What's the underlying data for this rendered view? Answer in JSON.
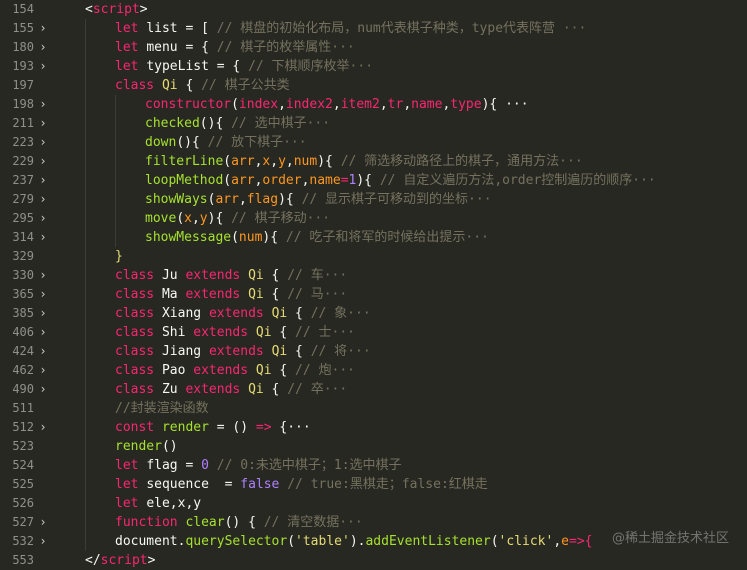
{
  "lines": [
    {
      "num": "154",
      "fold": "",
      "indent": 1,
      "tokens": [
        {
          "t": "<",
          "c": "t-punct"
        },
        {
          "t": "script",
          "c": "t-tag"
        },
        {
          "t": ">",
          "c": "t-punct"
        }
      ]
    },
    {
      "num": "155",
      "fold": "›",
      "indent": 2,
      "tokens": [
        {
          "t": "let ",
          "c": "t-kw2"
        },
        {
          "t": "list",
          "c": "t-plain"
        },
        {
          "t": " = [ ",
          "c": "t-plain"
        },
        {
          "t": "// 棋盘的初始化布局，num代表棋子种类，type代表阵营 ···",
          "c": "t-com"
        }
      ]
    },
    {
      "num": "180",
      "fold": "›",
      "indent": 2,
      "tokens": [
        {
          "t": "let ",
          "c": "t-kw2"
        },
        {
          "t": "menu",
          "c": "t-plain"
        },
        {
          "t": " = { ",
          "c": "t-plain"
        },
        {
          "t": "// 棋子的枚举属性···",
          "c": "t-com"
        }
      ]
    },
    {
      "num": "193",
      "fold": "›",
      "indent": 2,
      "tokens": [
        {
          "t": "let ",
          "c": "t-kw2"
        },
        {
          "t": "typeList",
          "c": "t-plain"
        },
        {
          "t": " = { ",
          "c": "t-plain"
        },
        {
          "t": "// 下棋顺序枚举···",
          "c": "t-com"
        }
      ]
    },
    {
      "num": "197",
      "fold": "",
      "indent": 2,
      "tokens": [
        {
          "t": "class ",
          "c": "t-kw2"
        },
        {
          "t": "Qi",
          "c": "t-yel"
        },
        {
          "t": " { ",
          "c": "t-plain"
        },
        {
          "t": "// 棋子公共类",
          "c": "t-com"
        }
      ]
    },
    {
      "num": "198",
      "fold": "›",
      "indent": 3,
      "tokens": [
        {
          "t": "constructor",
          "c": "t-kw2"
        },
        {
          "t": "(",
          "c": "t-plain"
        },
        {
          "t": "index",
          "c": "t-kw2"
        },
        {
          "t": ",",
          "c": "t-plain"
        },
        {
          "t": "index2",
          "c": "t-kw2"
        },
        {
          "t": ",",
          "c": "t-plain"
        },
        {
          "t": "item2",
          "c": "t-kw2"
        },
        {
          "t": ",",
          "c": "t-plain"
        },
        {
          "t": "tr",
          "c": "t-kw2"
        },
        {
          "t": ",",
          "c": "t-plain"
        },
        {
          "t": "name",
          "c": "t-kw2"
        },
        {
          "t": ",",
          "c": "t-plain"
        },
        {
          "t": "type",
          "c": "t-kw2"
        },
        {
          "t": "){ ···",
          "c": "t-plain"
        }
      ]
    },
    {
      "num": "211",
      "fold": "›",
      "indent": 3,
      "tokens": [
        {
          "t": "checked",
          "c": "t-name"
        },
        {
          "t": "(){ ",
          "c": "t-plain"
        },
        {
          "t": "// 选中棋子···",
          "c": "t-com"
        }
      ]
    },
    {
      "num": "223",
      "fold": "›",
      "indent": 3,
      "tokens": [
        {
          "t": "down",
          "c": "t-name"
        },
        {
          "t": "(){ ",
          "c": "t-plain"
        },
        {
          "t": "// 放下棋子···",
          "c": "t-com"
        }
      ]
    },
    {
      "num": "229",
      "fold": "›",
      "indent": 3,
      "tokens": [
        {
          "t": "filterLine",
          "c": "t-name"
        },
        {
          "t": "(",
          "c": "t-plain"
        },
        {
          "t": "arr",
          "c": "t-param"
        },
        {
          "t": ",",
          "c": "t-plain"
        },
        {
          "t": "x",
          "c": "t-param"
        },
        {
          "t": ",",
          "c": "t-plain"
        },
        {
          "t": "y",
          "c": "t-param"
        },
        {
          "t": ",",
          "c": "t-plain"
        },
        {
          "t": "num",
          "c": "t-param"
        },
        {
          "t": "){ ",
          "c": "t-plain"
        },
        {
          "t": "// 筛选移动路径上的棋子，通用方法···",
          "c": "t-com"
        }
      ]
    },
    {
      "num": "237",
      "fold": "›",
      "indent": 3,
      "tokens": [
        {
          "t": "loopMethod",
          "c": "t-name"
        },
        {
          "t": "(",
          "c": "t-plain"
        },
        {
          "t": "arr",
          "c": "t-param"
        },
        {
          "t": ",",
          "c": "t-plain"
        },
        {
          "t": "order",
          "c": "t-param"
        },
        {
          "t": ",",
          "c": "t-plain"
        },
        {
          "t": "name",
          "c": "t-param"
        },
        {
          "t": "=",
          "c": "t-kw2"
        },
        {
          "t": "1",
          "c": "t-num"
        },
        {
          "t": "){ ",
          "c": "t-plain"
        },
        {
          "t": "// 自定义遍历方法,order控制遍历的顺序···",
          "c": "t-com"
        }
      ]
    },
    {
      "num": "279",
      "fold": "›",
      "indent": 3,
      "tokens": [
        {
          "t": "showWays",
          "c": "t-name"
        },
        {
          "t": "(",
          "c": "t-plain"
        },
        {
          "t": "arr",
          "c": "t-param"
        },
        {
          "t": ",",
          "c": "t-plain"
        },
        {
          "t": "flag",
          "c": "t-param"
        },
        {
          "t": "){ ",
          "c": "t-plain"
        },
        {
          "t": "// 显示棋子可移动到的坐标···",
          "c": "t-com"
        }
      ]
    },
    {
      "num": "295",
      "fold": "›",
      "indent": 3,
      "tokens": [
        {
          "t": "move",
          "c": "t-name"
        },
        {
          "t": "(",
          "c": "t-plain"
        },
        {
          "t": "x",
          "c": "t-param"
        },
        {
          "t": ",",
          "c": "t-plain"
        },
        {
          "t": "y",
          "c": "t-param"
        },
        {
          "t": "){ ",
          "c": "t-plain"
        },
        {
          "t": "// 棋子移动···",
          "c": "t-com"
        }
      ]
    },
    {
      "num": "314",
      "fold": "›",
      "indent": 3,
      "tokens": [
        {
          "t": "showMessage",
          "c": "t-name"
        },
        {
          "t": "(",
          "c": "t-plain"
        },
        {
          "t": "num",
          "c": "t-param"
        },
        {
          "t": "){ ",
          "c": "t-plain"
        },
        {
          "t": "// 吃子和将军的时候给出提示···",
          "c": "t-com"
        }
      ]
    },
    {
      "num": "329",
      "fold": "",
      "indent": 2,
      "tokens": [
        {
          "t": "}",
          "c": "t-yel"
        }
      ]
    },
    {
      "num": "330",
      "fold": "›",
      "indent": 2,
      "tokens": [
        {
          "t": "class ",
          "c": "t-kw2"
        },
        {
          "t": "Ju ",
          "c": "t-plain"
        },
        {
          "t": "extends ",
          "c": "t-kw2"
        },
        {
          "t": "Qi",
          "c": "t-yel"
        },
        {
          "t": " { ",
          "c": "t-plain"
        },
        {
          "t": "// 车···",
          "c": "t-com"
        }
      ]
    },
    {
      "num": "365",
      "fold": "›",
      "indent": 2,
      "tokens": [
        {
          "t": "class ",
          "c": "t-kw2"
        },
        {
          "t": "Ma ",
          "c": "t-plain"
        },
        {
          "t": "extends ",
          "c": "t-kw2"
        },
        {
          "t": "Qi",
          "c": "t-yel"
        },
        {
          "t": " { ",
          "c": "t-plain"
        },
        {
          "t": "// 马···",
          "c": "t-com"
        }
      ]
    },
    {
      "num": "385",
      "fold": "›",
      "indent": 2,
      "tokens": [
        {
          "t": "class ",
          "c": "t-kw2"
        },
        {
          "t": "Xiang ",
          "c": "t-plain"
        },
        {
          "t": "extends ",
          "c": "t-kw2"
        },
        {
          "t": "Qi",
          "c": "t-yel"
        },
        {
          "t": " { ",
          "c": "t-plain"
        },
        {
          "t": "// 象···",
          "c": "t-com"
        }
      ]
    },
    {
      "num": "406",
      "fold": "›",
      "indent": 2,
      "tokens": [
        {
          "t": "class ",
          "c": "t-kw2"
        },
        {
          "t": "Shi ",
          "c": "t-plain"
        },
        {
          "t": "extends ",
          "c": "t-kw2"
        },
        {
          "t": "Qi",
          "c": "t-yel"
        },
        {
          "t": " { ",
          "c": "t-plain"
        },
        {
          "t": "// 士···",
          "c": "t-com"
        }
      ]
    },
    {
      "num": "424",
      "fold": "›",
      "indent": 2,
      "tokens": [
        {
          "t": "class ",
          "c": "t-kw2"
        },
        {
          "t": "Jiang ",
          "c": "t-plain"
        },
        {
          "t": "extends ",
          "c": "t-kw2"
        },
        {
          "t": "Qi",
          "c": "t-yel"
        },
        {
          "t": " { ",
          "c": "t-plain"
        },
        {
          "t": "// 将···",
          "c": "t-com"
        }
      ]
    },
    {
      "num": "462",
      "fold": "›",
      "indent": 2,
      "tokens": [
        {
          "t": "class ",
          "c": "t-kw2"
        },
        {
          "t": "Pao ",
          "c": "t-plain"
        },
        {
          "t": "extends ",
          "c": "t-kw2"
        },
        {
          "t": "Qi",
          "c": "t-yel"
        },
        {
          "t": " { ",
          "c": "t-plain"
        },
        {
          "t": "// 炮···",
          "c": "t-com"
        }
      ]
    },
    {
      "num": "490",
      "fold": "›",
      "indent": 2,
      "tokens": [
        {
          "t": "class ",
          "c": "t-kw2"
        },
        {
          "t": "Zu ",
          "c": "t-plain"
        },
        {
          "t": "extends ",
          "c": "t-kw2"
        },
        {
          "t": "Qi",
          "c": "t-yel"
        },
        {
          "t": " { ",
          "c": "t-plain"
        },
        {
          "t": "// 卒···",
          "c": "t-com"
        }
      ]
    },
    {
      "num": "511",
      "fold": "",
      "indent": 2,
      "tokens": [
        {
          "t": "//封装渲染函数",
          "c": "t-com"
        }
      ]
    },
    {
      "num": "512",
      "fold": "›",
      "indent": 2,
      "tokens": [
        {
          "t": "const ",
          "c": "t-kw2"
        },
        {
          "t": "render",
          "c": "t-name"
        },
        {
          "t": " = () ",
          "c": "t-plain"
        },
        {
          "t": "=>",
          "c": "t-kw2"
        },
        {
          "t": " {···",
          "c": "t-plain"
        }
      ]
    },
    {
      "num": "523",
      "fold": "",
      "indent": 2,
      "tokens": [
        {
          "t": "render",
          "c": "t-name"
        },
        {
          "t": "()",
          "c": "t-plain"
        }
      ]
    },
    {
      "num": "524",
      "fold": "",
      "indent": 2,
      "tokens": [
        {
          "t": "let ",
          "c": "t-kw2"
        },
        {
          "t": "flag",
          "c": "t-plain"
        },
        {
          "t": " = ",
          "c": "t-plain"
        },
        {
          "t": "0",
          "c": "t-num"
        },
        {
          "t": " // 0:未选中棋子；1:选中棋子",
          "c": "t-com"
        }
      ]
    },
    {
      "num": "525",
      "fold": "",
      "indent": 2,
      "tokens": [
        {
          "t": "let ",
          "c": "t-kw2"
        },
        {
          "t": "sequence",
          "c": "t-plain"
        },
        {
          "t": "  = ",
          "c": "t-plain"
        },
        {
          "t": "false",
          "c": "t-num"
        },
        {
          "t": " // true:黑棋走；false:红棋走",
          "c": "t-com"
        }
      ]
    },
    {
      "num": "526",
      "fold": "",
      "indent": 2,
      "tokens": [
        {
          "t": "let ",
          "c": "t-kw2"
        },
        {
          "t": "ele,x,y",
          "c": "t-plain"
        }
      ]
    },
    {
      "num": "527",
      "fold": "›",
      "indent": 2,
      "tokens": [
        {
          "t": "function ",
          "c": "t-kw2"
        },
        {
          "t": "clear",
          "c": "t-name"
        },
        {
          "t": "() { ",
          "c": "t-plain"
        },
        {
          "t": "// 清空数据···",
          "c": "t-com"
        }
      ]
    },
    {
      "num": "532",
      "fold": "›",
      "indent": 2,
      "tokens": [
        {
          "t": "document",
          "c": "t-plain"
        },
        {
          "t": ".",
          "c": "t-plain"
        },
        {
          "t": "querySelector",
          "c": "t-name"
        },
        {
          "t": "(",
          "c": "t-plain"
        },
        {
          "t": "'table'",
          "c": "t-str"
        },
        {
          "t": ").",
          "c": "t-plain"
        },
        {
          "t": "addEventListener",
          "c": "t-name"
        },
        {
          "t": "(",
          "c": "t-plain"
        },
        {
          "t": "'click'",
          "c": "t-str"
        },
        {
          "t": ",",
          "c": "t-plain"
        },
        {
          "t": "e",
          "c": "t-param"
        },
        {
          "t": "=>{",
          "c": "t-kw2"
        }
      ]
    },
    {
      "num": "553",
      "fold": "",
      "indent": 1,
      "tokens": [
        {
          "t": "</",
          "c": "t-punct"
        },
        {
          "t": "script",
          "c": "t-tag"
        },
        {
          "t": ">",
          "c": "t-punct"
        }
      ]
    }
  ],
  "watermark": "@稀土掘金技术社区"
}
